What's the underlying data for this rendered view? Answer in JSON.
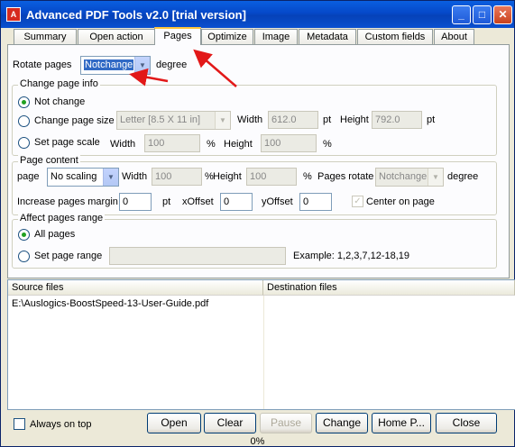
{
  "window": {
    "title": "Advanced PDF Tools  v2.0 [trial version]",
    "app_icon": "pdf-icon"
  },
  "tabs": [
    "Summary",
    "Open action",
    "Pages",
    "Optimize",
    "Image",
    "Metadata",
    "Custom fields",
    "About"
  ],
  "active_tab": "Pages",
  "rotate": {
    "label": "Rotate pages",
    "value": "Notchange",
    "unit": "degree"
  },
  "page_info": {
    "legend": "Change page info",
    "not_change": "Not change",
    "change_size": "Change page size",
    "size_value": "Letter [8.5 X 11 in]",
    "width_label": "Width",
    "width_value": "612.0",
    "width_unit": "pt",
    "height_label": "Height",
    "height_value": "792.0",
    "height_unit": "pt",
    "set_scale": "Set page scale",
    "scale_width_label": "Width",
    "scale_width_value": "100",
    "scale_width_unit": "%",
    "scale_height_label": "Height",
    "scale_height_value": "100",
    "scale_height_unit": "%"
  },
  "page_content": {
    "legend": "Page content",
    "page_label": "page",
    "page_value": "No scaling",
    "width_label": "Width",
    "width_value": "100",
    "width_unit": "%",
    "height_label": "Height",
    "height_value": "100",
    "height_unit": "%",
    "rotate_label": "Pages rotate",
    "rotate_value": "Notchange",
    "rotate_unit": "degree",
    "margin_label": "Increase pages margin",
    "margin_value": "0",
    "margin_unit": "pt",
    "xoffset_label": "xOffset",
    "xoffset_value": "0",
    "yoffset_label": "yOffset",
    "yoffset_value": "0",
    "center_label": "Center on page"
  },
  "range": {
    "legend": "Affect pages range",
    "all": "All pages",
    "set": "Set page range",
    "set_value": "",
    "example": "Example: 1,2,3,7,12-18,19"
  },
  "files": {
    "source_header": "Source files",
    "dest_header": "Destination files",
    "rows": [
      {
        "source": "E:\\Auslogics-BoostSpeed-13-User-Guide.pdf",
        "dest": ""
      }
    ]
  },
  "bottom": {
    "always_on_top": "Always on top",
    "open": "Open",
    "clear": "Clear",
    "pause": "Pause",
    "change": "Change",
    "home": "Home P...",
    "close": "Close"
  },
  "status": {
    "progress": "0%"
  }
}
